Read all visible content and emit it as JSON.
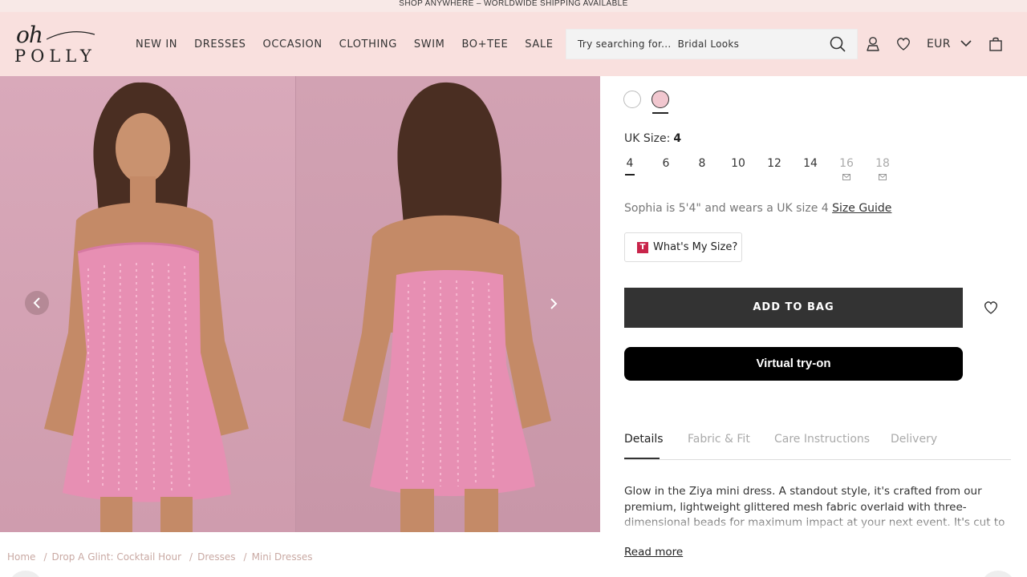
{
  "promo": {
    "text": "SHOP ANYWHERE – WORLDWIDE SHIPPING AVAILABLE"
  },
  "brand": {
    "logo_top": "oh",
    "logo_bottom": "POLLY"
  },
  "nav": {
    "items": [
      "NEW IN",
      "DRESSES",
      "OCCASION",
      "CLOTHING",
      "SWIM",
      "BO+TEE",
      "SALE"
    ]
  },
  "search": {
    "placeholder": "Try searching for...",
    "suggestion": "Bridal Looks"
  },
  "header": {
    "currency": "EUR"
  },
  "gallery": {
    "photo_count": 2
  },
  "breadcrumb": [
    "Home",
    "Drop A Glint: Cocktail Hour",
    "Dresses",
    "Mini Dresses"
  ],
  "product": {
    "colors": [
      {
        "name": "white",
        "hex": "#ffffff"
      },
      {
        "name": "pink",
        "hex": "#f1c7cf",
        "selected": true
      }
    ],
    "size_label": "UK Size:",
    "selected_size": "4",
    "sizes": [
      {
        "label": "4",
        "available": true,
        "selected": true
      },
      {
        "label": "6",
        "available": true
      },
      {
        "label": "8",
        "available": true
      },
      {
        "label": "10",
        "available": true
      },
      {
        "label": "12",
        "available": true
      },
      {
        "label": "14",
        "available": true
      },
      {
        "label": "16",
        "available": false
      },
      {
        "label": "18",
        "available": false
      }
    ],
    "model_info": "Sophia is 5'4\" and wears a UK size 4",
    "size_guide": "Size Guide",
    "whats_my_size": "What's My Size?",
    "add_to_bag": "ADD TO BAG",
    "virtual_try_on": "Virtual try-on",
    "tabs": [
      "Details",
      "Fabric & Fit",
      "Care Instructions",
      "Delivery"
    ],
    "active_tab": "Details",
    "description": "Glow in the Ziya mini dress. A standout style, it's crafted from our premium, lightweight glittered mesh fabric overlaid with three-dimensional beads for maximum impact at your next event. It's cut to a universally flattering A-",
    "read_more": "Read more"
  },
  "colors": {
    "header_bg": "#f9e0de",
    "promo_bg": "#f8e9e7",
    "dress_pink": "#e78fb3",
    "backdrop": "#d5a4b5"
  }
}
